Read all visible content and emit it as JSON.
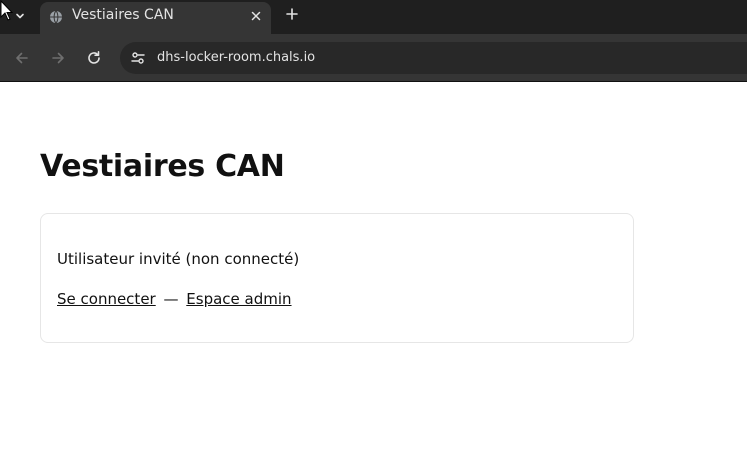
{
  "browser": {
    "tab_title": "Vestiaires CAN",
    "url": "dhs-locker-room.chals.io",
    "icons": {
      "tab_menu": "chevron-down-icon",
      "favicon": "globe-icon",
      "close": "close-icon",
      "new_tab": "plus-icon",
      "back": "arrow-left-icon",
      "forward": "arrow-right-icon",
      "reload": "reload-icon",
      "site_info": "tune-icon"
    }
  },
  "page": {
    "title": "Vestiaires CAN",
    "status_text": "Utilisateur invité (non connecté)",
    "login_link": "Se connecter",
    "separator": "—",
    "admin_link": "Espace admin"
  }
}
